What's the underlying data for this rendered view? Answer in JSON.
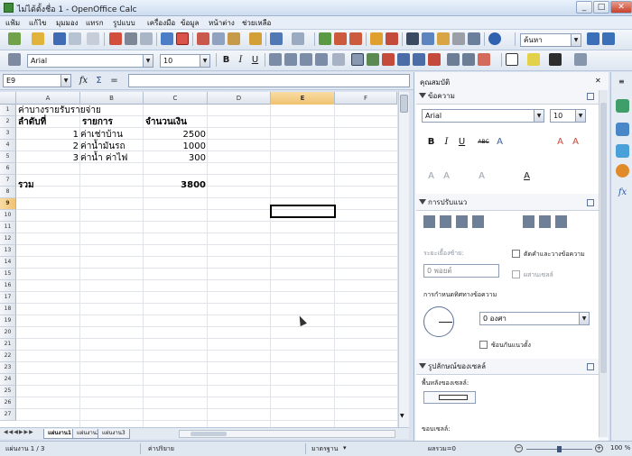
{
  "window": {
    "title": "ไม่ได้ตั้งชื่อ 1 - OpenOffice Calc",
    "min": "_",
    "max": "□",
    "close": "✕"
  },
  "menu": [
    "แฟ้ม",
    "แก้ไข",
    "มุมมอง",
    "แทรก",
    "รูปแบบ",
    "เครื่องมือ",
    "ข้อมูล",
    "หน้าต่าง",
    "ช่วยเหลือ"
  ],
  "toolbar": {
    "find_value": "ค้นหา"
  },
  "format": {
    "font": "Arial",
    "size": "10"
  },
  "formula": {
    "cell_ref": "E9",
    "fx": "fx",
    "sum": "Σ",
    "eq": "=",
    "value": ""
  },
  "columns": [
    "A",
    "B",
    "C",
    "D",
    "E",
    "F"
  ],
  "rows": [
    "1",
    "2",
    "3",
    "4",
    "5",
    "6",
    "7",
    "8",
    "9",
    "10",
    "11",
    "12",
    "13",
    "14",
    "15",
    "16",
    "17",
    "18",
    "19",
    "20",
    "21",
    "22",
    "23",
    "24",
    "25",
    "26",
    "27"
  ],
  "cells": {
    "a1": "ค่าบางรายรับรายจ่าย",
    "a2": "ลำดับที่",
    "b2": "รายการ",
    "c2": "จำนวนเงิน",
    "a3": "1",
    "b3": "ค่าเช่าบ้าน",
    "c3": "2500",
    "a4": "2",
    "b4": "ค่าน้ำมันรถ",
    "c4": "1000",
    "a5": "3",
    "b5": "ค่าน้ำ ค่าไฟ",
    "c5": "300",
    "a7": "รวม",
    "c7": "3800"
  },
  "sheet_tabs": [
    "แผ่นงาน1",
    "แผ่นงาน2",
    "แผ่นงาน3"
  ],
  "status": {
    "sheet": "แผ่นงาน 1 / 3",
    "style": "ค่าปริยาย",
    "mode": "มาตรฐาน",
    "sum": "ผลรวม=0",
    "zoom": "100 %"
  },
  "sidebar": {
    "title": "คุณสมบัติ",
    "text_section": "ข้อความ",
    "font": "Arial",
    "size": "10",
    "align_section": "การปรับแนว",
    "indent_label": "ระยะเยื้องซ้าย:",
    "indent_value": "0 พอยต์",
    "wrap_label": "ตัดคำและวางข้อความ",
    "merge_label": "ผสานเซลล์",
    "orient_label": "การกำหนดทิศทางข้อความ",
    "orient_value": "0 องศา",
    "stack_label": "ซ้อนกันแนวตั้ง",
    "cell_section": "รูปลักษณ์ของเซลล์",
    "bg_label": "พื้นหลังของเซลล์:",
    "border_label": "ขอบเซลล์:"
  }
}
